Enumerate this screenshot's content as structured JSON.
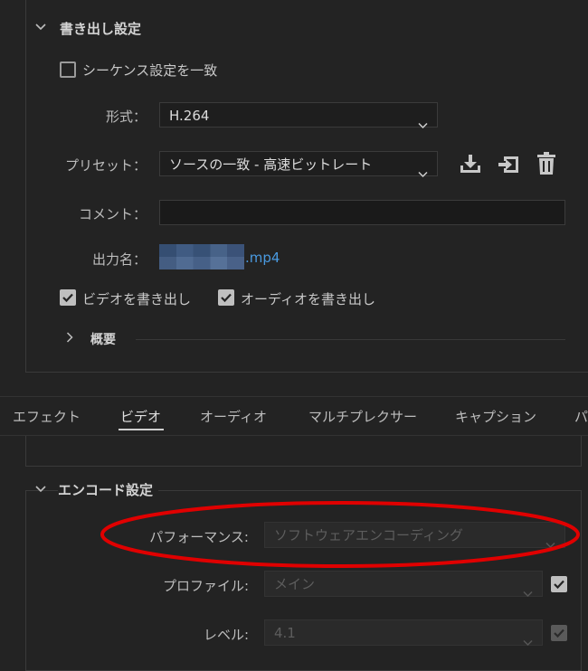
{
  "export_settings": {
    "title": "書き出し設定",
    "match_sequence_label": "シーケンス設定を一致",
    "format_label": "形式：",
    "format_value": "H.264",
    "preset_label": "プリセット：",
    "preset_value": "ソースの一致 - 高速ビットレート",
    "comment_label": "コメント：",
    "comment_value": "",
    "output_name_label": "出力名：",
    "output_name_suffix": ".mp4",
    "export_video_label": "ビデオを書き出し",
    "export_audio_label": "オーディオを書き出し",
    "summary_label": "概要"
  },
  "tabs": [
    {
      "label": "エフェクト"
    },
    {
      "label": "ビデオ"
    },
    {
      "label": "オーディオ"
    },
    {
      "label": "マルチプレクサー"
    },
    {
      "label": "キャプション"
    },
    {
      "label": "パ"
    }
  ],
  "active_tab": "ビデオ",
  "encode_settings": {
    "title": "エンコード設定",
    "performance_label": "パフォーマンス:",
    "performance_value": "ソフトウェアエンコーディング",
    "profile_label": "プロファイル:",
    "profile_value": "メイン",
    "level_label": "レベル:",
    "level_value": "4.1"
  },
  "colors": {
    "background": "#232323",
    "highlight_ellipse": "#e00000",
    "link_blue": "#4a9ae0"
  }
}
